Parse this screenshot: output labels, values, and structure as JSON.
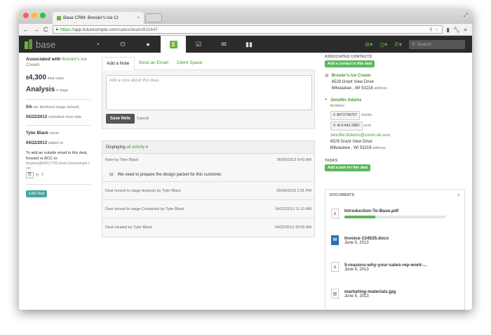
{
  "browser": {
    "tab_title": "Base CRM: Bresler's Ice Cr",
    "url_https": "https://",
    "url_host": "app.futuresimple.com",
    "url_path": "/sales/deals/811447"
  },
  "app": {
    "logo_text": "base",
    "search_placeholder": "Search"
  },
  "deal": {
    "associated_label": "Associated with",
    "company": "Bresler's Ice Cream",
    "currency": "$",
    "value": "4,300",
    "value_label": "deal value",
    "stage": "Analysis",
    "stage_label": "stage",
    "win_likelihood": "5%",
    "win_likelihood_label": "win likelihood (stage default)",
    "close_date": "05/22/2013",
    "close_date_label": "estimated close date",
    "owner": "Tyler Black",
    "owner_label": "owner",
    "added_on": "04/22/2013",
    "added_on_label": "added on",
    "email_instructions": "To add an outside email to this deal, forward or BCC to:",
    "dropbox": "dropbox@45617783.deals.futuresimple.com",
    "edit_button": "Edit Deal"
  },
  "notes": {
    "tabs": [
      "Add a Note",
      "Send an Email",
      "Client Space"
    ],
    "placeholder": "Add a note about this deal.",
    "save_button": "Save Note",
    "cancel": "Cancel"
  },
  "activity": {
    "displaying": "Displaying",
    "filter": "all activity",
    "items": [
      {
        "title": "Note by Tyler Black",
        "date": "06/05/2013 9:41 AM",
        "body": "We need to prepare the design packet for this customer."
      },
      {
        "title": "Deal moved to stage Analysis by Tyler Black",
        "date": "05/08/2013 2:31 PM"
      },
      {
        "title": "Deal moved to stage Contacted by Tyler Black",
        "date": "04/22/2013 11:11 AM"
      },
      {
        "title": "Deal created by Tyler Black",
        "date": "04/22/2013 10:55 AM"
      }
    ]
  },
  "contacts": {
    "title": "ASSOCIATED CONTACTS",
    "add_button": "Add a contact to this deal",
    "company": {
      "name": "Bresler's Ice Cream",
      "street": "4529 Grant View Drive",
      "city": "Milwaukee , WI 53216",
      "address_label": "address"
    },
    "person": {
      "name": "Jennifer Adams",
      "title": "Architect",
      "mobile": "8472740707",
      "mobile_label": "mobile",
      "work_phone": "414-442-2881",
      "work_label": "work",
      "email": "JenniferJAdams@cuvox.de",
      "email_label": "work",
      "street": "4529 Grant View Drive",
      "city": "Milwaukee , WI 53216",
      "address_label": "address"
    }
  },
  "tasks": {
    "title": "TASKS",
    "add_button": "Add a task for this deal"
  },
  "documents": {
    "title": "DOCUMENTS",
    "add": "+",
    "files": [
      {
        "name": "Introduction-To-Base.pdf",
        "type": "pdf",
        "upload_progress": 0.3
      },
      {
        "name": "Invoice-134535.docx",
        "type": "docx",
        "date": "June 5, 2013"
      },
      {
        "name": "5-reasons-why-your-sales-rep-wont-...",
        "type": "pdf",
        "date": "June 5, 2013"
      },
      {
        "name": "marketing-materials.jpg",
        "type": "image",
        "date": "June 5, 2013"
      }
    ]
  },
  "colors": {
    "brand_green": "#6cb33f",
    "nav_dark": "#2b2b2b"
  }
}
